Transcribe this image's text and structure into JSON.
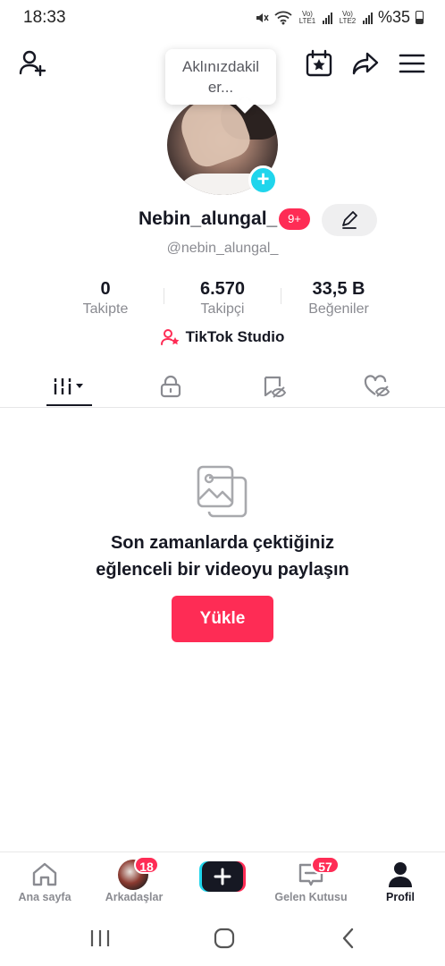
{
  "status_bar": {
    "time": "18:33",
    "lte1": "Vo) LTE1",
    "lte2": "Vo) LTE2",
    "battery": "%35"
  },
  "tooltip": {
    "text": "Aklınızdakil er..."
  },
  "profile": {
    "username": "Nebin_alungal_",
    "badge": "9+",
    "handle": "@nebin_alungal_"
  },
  "stats": [
    {
      "value": "0",
      "label": "Takipte"
    },
    {
      "value": "6.570",
      "label": "Takipçi"
    },
    {
      "value": "33,5 B",
      "label": "Beğeniler"
    }
  ],
  "studio": {
    "label": "TikTok Studio"
  },
  "empty_state": {
    "line1": "Son zamanlarda çektiğiniz",
    "line2": "eğlenceli bir videoyu paylaşın",
    "button": "Yükle"
  },
  "bottom_nav": {
    "home": "Ana sayfa",
    "friends": "Arkadaşlar",
    "friends_badge": "18",
    "inbox": "Gelen Kutusu",
    "inbox_badge": "57",
    "profile": "Profil"
  },
  "colors": {
    "accent": "#fe2c55",
    "cyan": "#20d5ec",
    "text": "#161823",
    "muted": "#8a8b91"
  }
}
